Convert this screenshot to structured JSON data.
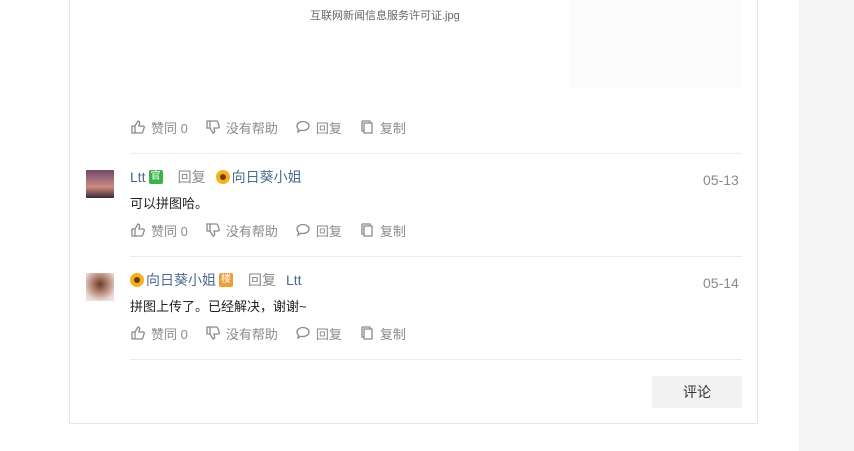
{
  "attachment": {
    "caption": "互联网新闻信息服务许可证.jpg"
  },
  "post_actions": {
    "like": "赞同 0",
    "unhelpful": "没有帮助",
    "reply": "回复",
    "copy": "复制"
  },
  "comments": [
    {
      "author": "Ltt",
      "badge": "官",
      "reply_label": "回复",
      "reply_to": "向日葵小姐",
      "date": "05-13",
      "text": "可以拼图哈。",
      "actions": {
        "like": "赞同 0",
        "unhelpful": "没有帮助",
        "reply": "回复",
        "copy": "复制"
      }
    },
    {
      "author": "向日葵小姐",
      "badge": "楼",
      "reply_label": "回复",
      "reply_to": "Ltt",
      "date": "05-14",
      "text": "拼图上传了。已经解决，谢谢~",
      "actions": {
        "like": "赞同 0",
        "unhelpful": "没有帮助",
        "reply": "回复",
        "copy": "复制"
      }
    }
  ],
  "comment_button": "评论",
  "colors": {
    "name_link": "#4a6b8f",
    "muted": "#8a8a8a",
    "official_badge": "#3cb34a",
    "op_badge": "#f19b3a"
  }
}
